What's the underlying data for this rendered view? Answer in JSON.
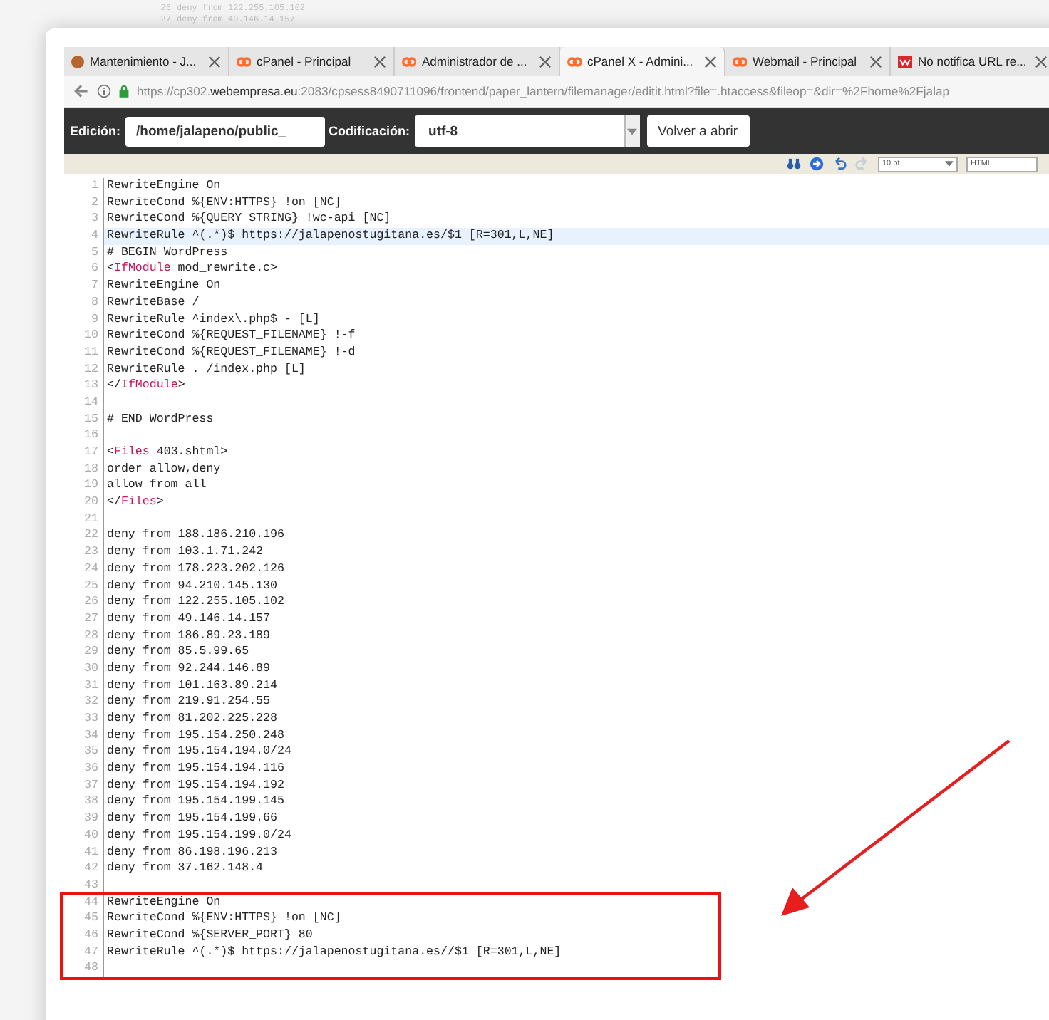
{
  "background_lines": [
    {
      "number": "26",
      "text": "deny from 122.255.105.102"
    },
    {
      "number": "27",
      "text": "deny from 49.146.14.157"
    }
  ],
  "tabs": [
    {
      "label": "Mantenimiento - J...",
      "selected": false
    },
    {
      "label": "cPanel - Principal",
      "selected": false
    },
    {
      "label": "Administrador de ...",
      "selected": false
    },
    {
      "label": "cPanel X - Admini...",
      "selected": true
    },
    {
      "label": "Webmail - Principal",
      "selected": false
    },
    {
      "label": "No notifica URL re...",
      "selected": false
    }
  ],
  "address": {
    "pre": "https://cp302.",
    "host": "webempresa.eu",
    "post": ":2083/cpsess8490711096/frontend/paper_lantern/filemanager/editit.html?file=.htaccess&fileop=&dir=%2Fhome%2Fjalap"
  },
  "toolbar": {
    "edit_label": "Edición:",
    "path": "/home/jalapeno/public_",
    "encoding_label": "Codificación:",
    "encoding": "utf-8",
    "reopen_button": "Volver a abrir"
  },
  "editor_toolbar": {
    "font_size": "10 pt",
    "syntax": "HTML"
  },
  "code": [
    {
      "n": "1",
      "selected": false,
      "seg": [
        {
          "t": "RewriteEngine On",
          "kind": "text"
        }
      ]
    },
    {
      "n": "2",
      "selected": false,
      "seg": [
        {
          "t": "RewriteCond %{ENV:HTTPS} !on [NC]",
          "kind": "text"
        }
      ]
    },
    {
      "n": "3",
      "selected": false,
      "seg": [
        {
          "t": "RewriteCond %{QUERY_STRING} !wc-api [NC]",
          "kind": "text"
        }
      ]
    },
    {
      "n": "4",
      "selected": true,
      "seg": [
        {
          "t": "RewriteRule ^(.*)$ https://jalapenostugitana.es/$1 [R=301,L,NE]",
          "kind": "text"
        }
      ]
    },
    {
      "n": "5",
      "selected": false,
      "seg": [
        {
          "t": "# BEGIN WordPress",
          "kind": "text"
        }
      ]
    },
    {
      "n": "6",
      "selected": false,
      "seg": [
        {
          "t": "<",
          "kind": "text"
        },
        {
          "t": "IfModule",
          "kind": "tag"
        },
        {
          "t": " mod_rewrite.c>",
          "kind": "text"
        }
      ]
    },
    {
      "n": "7",
      "selected": false,
      "seg": [
        {
          "t": "RewriteEngine On",
          "kind": "text"
        }
      ]
    },
    {
      "n": "8",
      "selected": false,
      "seg": [
        {
          "t": "RewriteBase /",
          "kind": "text"
        }
      ]
    },
    {
      "n": "9",
      "selected": false,
      "seg": [
        {
          "t": "RewriteRule ^index\\.php$ - [L]",
          "kind": "text"
        }
      ]
    },
    {
      "n": "10",
      "selected": false,
      "seg": [
        {
          "t": "RewriteCond %{REQUEST_FILENAME} !-f",
          "kind": "text"
        }
      ]
    },
    {
      "n": "11",
      "selected": false,
      "seg": [
        {
          "t": "RewriteCond %{REQUEST_FILENAME} !-d",
          "kind": "text"
        }
      ]
    },
    {
      "n": "12",
      "selected": false,
      "seg": [
        {
          "t": "RewriteRule . /index.php [L]",
          "kind": "text"
        }
      ]
    },
    {
      "n": "13",
      "selected": false,
      "seg": [
        {
          "t": "</",
          "kind": "text"
        },
        {
          "t": "IfModule",
          "kind": "tag"
        },
        {
          "t": ">",
          "kind": "text"
        }
      ]
    },
    {
      "n": "14",
      "selected": false
    },
    {
      "n": "15",
      "selected": false,
      "seg": [
        {
          "t": "# END WordPress",
          "kind": "text"
        }
      ]
    },
    {
      "n": "16",
      "selected": false
    },
    {
      "n": "17",
      "selected": false,
      "seg": [
        {
          "t": "<",
          "kind": "text"
        },
        {
          "t": "Files",
          "kind": "tag"
        },
        {
          "t": " 403.shtml>",
          "kind": "text"
        }
      ]
    },
    {
      "n": "18",
      "selected": false,
      "seg": [
        {
          "t": "order allow,deny",
          "kind": "text"
        }
      ]
    },
    {
      "n": "19",
      "selected": false,
      "seg": [
        {
          "t": "allow from all",
          "kind": "text"
        }
      ]
    },
    {
      "n": "20",
      "selected": false,
      "seg": [
        {
          "t": "</",
          "kind": "text"
        },
        {
          "t": "Files",
          "kind": "tag"
        },
        {
          "t": ">",
          "kind": "text"
        }
      ]
    },
    {
      "n": "21",
      "selected": false
    },
    {
      "n": "22",
      "selected": false,
      "seg": [
        {
          "t": "deny from 188.186.210.196",
          "kind": "text"
        }
      ]
    },
    {
      "n": "23",
      "selected": false,
      "seg": [
        {
          "t": "deny from 103.1.71.242",
          "kind": "text"
        }
      ]
    },
    {
      "n": "24",
      "selected": false,
      "seg": [
        {
          "t": "deny from 178.223.202.126",
          "kind": "text"
        }
      ]
    },
    {
      "n": "25",
      "selected": false,
      "seg": [
        {
          "t": "deny from 94.210.145.130",
          "kind": "text"
        }
      ]
    },
    {
      "n": "26",
      "selected": false,
      "seg": [
        {
          "t": "deny from 122.255.105.102",
          "kind": "text"
        }
      ]
    },
    {
      "n": "27",
      "selected": false,
      "seg": [
        {
          "t": "deny from 49.146.14.157",
          "kind": "text"
        }
      ]
    },
    {
      "n": "28",
      "selected": false,
      "seg": [
        {
          "t": "deny from 186.89.23.189",
          "kind": "text"
        }
      ]
    },
    {
      "n": "29",
      "selected": false,
      "seg": [
        {
          "t": "deny from 85.5.99.65",
          "kind": "text"
        }
      ]
    },
    {
      "n": "30",
      "selected": false,
      "seg": [
        {
          "t": "deny from 92.244.146.89",
          "kind": "text"
        }
      ]
    },
    {
      "n": "31",
      "selected": false,
      "seg": [
        {
          "t": "deny from 101.163.89.214",
          "kind": "text"
        }
      ]
    },
    {
      "n": "32",
      "selected": false,
      "seg": [
        {
          "t": "deny from 219.91.254.55",
          "kind": "text"
        }
      ]
    },
    {
      "n": "33",
      "selected": false,
      "seg": [
        {
          "t": "deny from 81.202.225.228",
          "kind": "text"
        }
      ]
    },
    {
      "n": "34",
      "selected": false,
      "seg": [
        {
          "t": "deny from 195.154.250.248",
          "kind": "text"
        }
      ]
    },
    {
      "n": "35",
      "selected": false,
      "seg": [
        {
          "t": "deny from 195.154.194.0/24",
          "kind": "text"
        }
      ]
    },
    {
      "n": "36",
      "selected": false,
      "seg": [
        {
          "t": "deny from 195.154.194.116",
          "kind": "text"
        }
      ]
    },
    {
      "n": "37",
      "selected": false,
      "seg": [
        {
          "t": "deny from 195.154.194.192",
          "kind": "text"
        }
      ]
    },
    {
      "n": "38",
      "selected": false,
      "seg": [
        {
          "t": "deny from 195.154.199.145",
          "kind": "text"
        }
      ]
    },
    {
      "n": "39",
      "selected": false,
      "seg": [
        {
          "t": "deny from 195.154.199.66",
          "kind": "text"
        }
      ]
    },
    {
      "n": "40",
      "selected": false,
      "seg": [
        {
          "t": "deny from 195.154.199.0/24",
          "kind": "text"
        }
      ]
    },
    {
      "n": "41",
      "selected": false,
      "seg": [
        {
          "t": "deny from 86.198.196.213",
          "kind": "text"
        }
      ]
    },
    {
      "n": "42",
      "selected": false,
      "seg": [
        {
          "t": "deny from 37.162.148.4",
          "kind": "text"
        }
      ]
    },
    {
      "n": "43",
      "selected": false
    },
    {
      "n": "44",
      "selected": false,
      "seg": [
        {
          "t": "RewriteEngine On",
          "kind": "text"
        }
      ]
    },
    {
      "n": "45",
      "selected": false,
      "seg": [
        {
          "t": "RewriteCond %{ENV:HTTPS} !on [NC]",
          "kind": "text"
        }
      ]
    },
    {
      "n": "46",
      "selected": false,
      "seg": [
        {
          "t": "RewriteCond %{SERVER_PORT} 80",
          "kind": "text"
        }
      ]
    },
    {
      "n": "47",
      "selected": false,
      "seg": [
        {
          "t": "RewriteRule ^(.*)$ https://jalapenostugitana.es//$1 [R=301,L,NE]",
          "kind": "text"
        }
      ]
    },
    {
      "n": "48",
      "selected": false
    }
  ]
}
